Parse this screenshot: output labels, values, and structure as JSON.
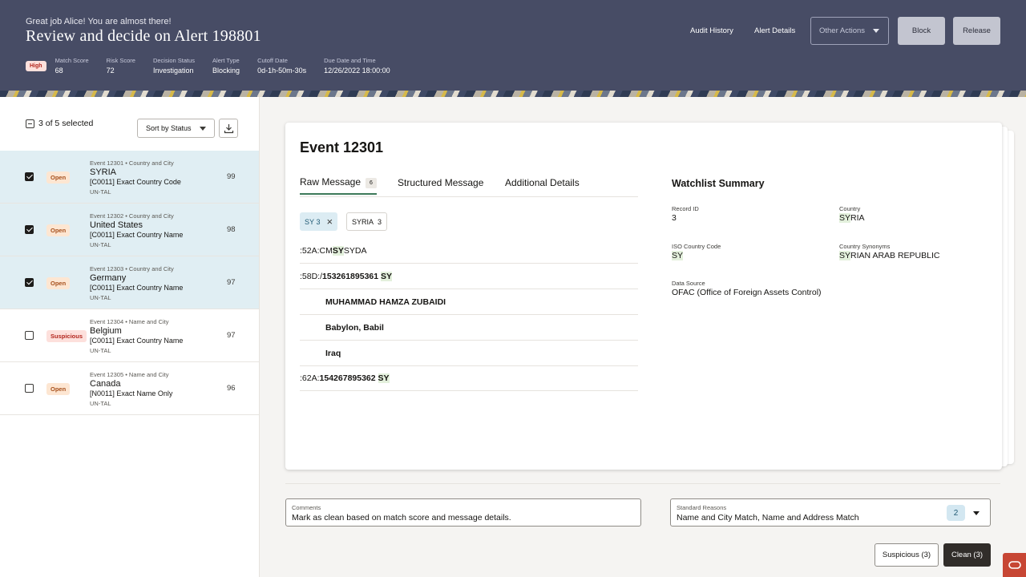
{
  "header": {
    "greeting": "Great job Alice! You are almost there!",
    "title": "Review and decide on Alert 198801",
    "priority": "High",
    "meta": [
      {
        "label": "Match Score",
        "value": "68"
      },
      {
        "label": "Risk Score",
        "value": "72"
      },
      {
        "label": "Decision Status",
        "value": "Investigation"
      },
      {
        "label": "Alert Type",
        "value": "Blocking"
      },
      {
        "label": "Cutoff Date",
        "value": "0d-1h-50m-30s"
      },
      {
        "label": "Due Date and Time",
        "value": "12/26/2022 18:00:00"
      }
    ],
    "audit_history": "Audit History",
    "alert_details": "Alert Details",
    "other_actions": "Other Actions",
    "block": "Block",
    "release": "Release"
  },
  "left": {
    "selection": "3 of 5 selected",
    "sort": "Sort by Status",
    "events": [
      {
        "head": "Event 12301 • Country and City",
        "name": "SYRIA",
        "rule": "[C0011] Exact Country Code",
        "source": "UN-TAL",
        "status": "Open",
        "score": "99",
        "checked": true
      },
      {
        "head": "Event 12302 • Country and City",
        "name": "United States",
        "rule": "[C0011] Exact Country Name",
        "source": "UN-TAL",
        "status": "Open",
        "score": "98",
        "checked": true
      },
      {
        "head": "Event 12303 • Country and City",
        "name": "Germany",
        "rule": "[C0011] Exact Country Name",
        "source": "UN-TAL",
        "status": "Open",
        "score": "97",
        "checked": true
      },
      {
        "head": "Event 12304 • Name and City",
        "name": "Belgium",
        "rule": "[C0011] Exact Country Name",
        "source": "UN-TAL",
        "status": "Suspicious",
        "score": "97",
        "checked": false
      },
      {
        "head": "Event 12305 • Name and City",
        "name": "Canada",
        "rule": "[N0011] Exact Name Only",
        "source": "UN-TAL",
        "status": "Open",
        "score": "96",
        "checked": false
      }
    ]
  },
  "detail": {
    "title": "Event 12301",
    "tabs": {
      "raw": "Raw Message",
      "raw_count": "6",
      "structured": "Structured Message",
      "additional": "Additional Details"
    },
    "chips": {
      "sy": "SY",
      "sy_count": "3",
      "syria": "SYRIA",
      "syria_count": "3"
    },
    "messages": {
      "l1_pre": ":52A:CM",
      "l1_hl": "SY",
      "l1_post": "SYDA",
      "l2_pre": ":58D:/",
      "l2_num": "153261895361",
      "l2_hl": "SY",
      "l3": "MUHAMMAD HAMZA ZUBAIDI",
      "l4": "Babylon, Babil",
      "l5": "Iraq",
      "l6_pre": ":62A:",
      "l6_num": "154267895362",
      "l6_hl": "SY"
    },
    "watchlist": {
      "title": "Watchlist Summary",
      "record_label": "Record ID",
      "record_value": "3",
      "country_label": "Country",
      "country_hl": "SY",
      "country_rest": "RIA",
      "iso_label": "ISO Country Code",
      "iso_value": "SY",
      "syn_label": "Country Synonyms",
      "syn_hl": "SY",
      "syn_rest": "RIAN ARAB REPUBLIC",
      "source_label": "Data Source",
      "source_value": "OFAC (Office of Foreign Assets Control)"
    }
  },
  "footer": {
    "comments_label": "Comments",
    "comments_value": "Mark as clean based on match score and message details.",
    "reasons_label": "Standard Reasons",
    "reasons_value": "Name and City Match, Name and Address Match",
    "reasons_count": "2",
    "suspicious": "Suspicious (3)",
    "clean": "Clean (3)"
  }
}
